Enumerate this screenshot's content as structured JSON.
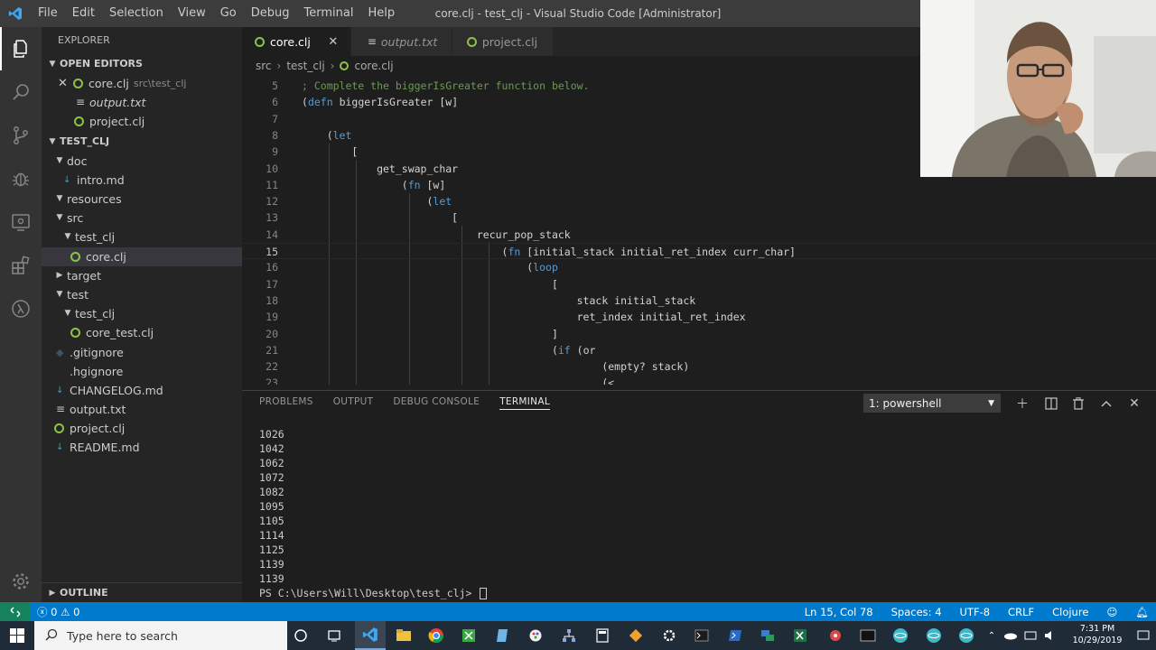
{
  "window": {
    "title": "core.clj - test_clj - Visual Studio Code [Administrator]",
    "menu": [
      "File",
      "Edit",
      "Selection",
      "View",
      "Go",
      "Debug",
      "Terminal",
      "Help"
    ]
  },
  "sidebar": {
    "header": "EXPLORER",
    "open_editors": {
      "title": "OPEN EDITORS",
      "items": [
        {
          "name": "core.clj",
          "desc": "src\\test_clj"
        },
        {
          "name": "output.txt",
          "desc": ""
        },
        {
          "name": "project.clj",
          "desc": ""
        }
      ]
    },
    "workspace": {
      "title": "TEST_CLJ",
      "items": [
        {
          "label": "doc"
        },
        {
          "label": "intro.md"
        },
        {
          "label": "resources"
        },
        {
          "label": "src"
        },
        {
          "label": "test_clj"
        },
        {
          "label": "core.clj"
        },
        {
          "label": "target"
        },
        {
          "label": "test"
        },
        {
          "label": "test_clj"
        },
        {
          "label": "core_test.clj"
        },
        {
          "label": ".gitignore"
        },
        {
          "label": ".hgignore"
        },
        {
          "label": "CHANGELOG.md"
        },
        {
          "label": "output.txt"
        },
        {
          "label": "project.clj"
        },
        {
          "label": "README.md"
        }
      ]
    },
    "outline": "OUTLINE"
  },
  "tabs": [
    {
      "label": "core.clj"
    },
    {
      "label": "output.txt"
    },
    {
      "label": "project.clj"
    }
  ],
  "breadcrumb": [
    "src",
    "test_clj",
    "core.clj"
  ],
  "code": {
    "lines": [
      {
        "n": "5",
        "a": "",
        "b": "; Complete the biggerIsGreater function below.",
        "c": ""
      },
      {
        "n": "6",
        "a": "(",
        "b": "defn",
        "c": " biggerIsGreater [w]"
      },
      {
        "n": "7",
        "a": "",
        "b": "",
        "c": ""
      },
      {
        "n": "8",
        "a": "    (",
        "b": "let",
        "c": ""
      },
      {
        "n": "9",
        "a": "        [",
        "b": "",
        "c": ""
      },
      {
        "n": "10",
        "a": "            get_swap_char",
        "b": "",
        "c": ""
      },
      {
        "n": "11",
        "a": "                (",
        "b": "fn",
        "c": " [w]"
      },
      {
        "n": "12",
        "a": "                    (",
        "b": "let",
        "c": ""
      },
      {
        "n": "13",
        "a": "                        [",
        "b": "",
        "c": ""
      },
      {
        "n": "14",
        "a": "                            recur_pop_stack",
        "b": "",
        "c": ""
      },
      {
        "n": "15",
        "a": "                                (",
        "b": "fn",
        "c": " [initial_stack initial_ret_index curr_char]"
      },
      {
        "n": "16",
        "a": "                                    (",
        "b": "loop",
        "c": ""
      },
      {
        "n": "17",
        "a": "                                        [",
        "b": "",
        "c": ""
      },
      {
        "n": "18",
        "a": "                                            stack initial_stack",
        "b": "",
        "c": ""
      },
      {
        "n": "19",
        "a": "                                            ret_index initial_ret_index",
        "b": "",
        "c": ""
      },
      {
        "n": "20",
        "a": "                                        ]",
        "b": "",
        "c": ""
      },
      {
        "n": "21",
        "a": "                                        (",
        "b": "if",
        "c": " (or"
      },
      {
        "n": "22",
        "a": "                                                (empty? stack)",
        "b": "",
        "c": ""
      },
      {
        "n": "23",
        "a": "                                                (<",
        "b": "",
        "c": ""
      }
    ]
  },
  "panel": {
    "tabs": [
      "PROBLEMS",
      "OUTPUT",
      "DEBUG CONSOLE",
      "TERMINAL"
    ],
    "terminal_select": "1: powershell",
    "output": [
      "1026",
      "1042",
      "1062",
      "1072",
      "1082",
      "1095",
      "1105",
      "1114",
      "1125",
      "1139",
      "1139"
    ],
    "prompt": "PS C:\\Users\\Will\\Desktop\\test_clj> "
  },
  "status": {
    "errors": "0",
    "warnings": "0",
    "position": "Ln 15, Col 78",
    "spaces": "Spaces: 4",
    "encoding": "UTF-8",
    "eol": "CRLF",
    "language": "Clojure"
  },
  "taskbar": {
    "search_placeholder": "Type here to search",
    "time": "7:31 PM",
    "date": "10/29/2019"
  },
  "colors": {
    "accent": "#007acc",
    "titlebar": "#3c3c3c",
    "editor_bg": "#1e1e1e",
    "sidebar_bg": "#252526",
    "clojure_icon": "#8dc149",
    "taskbar": "#202b38"
  }
}
